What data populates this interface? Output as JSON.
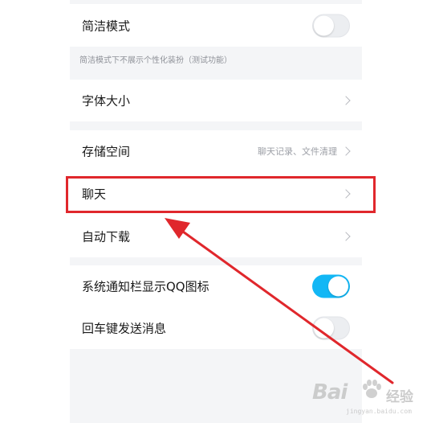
{
  "settings": {
    "simple_mode": {
      "label": "简洁模式",
      "enabled": false,
      "hint": "简洁模式下不展示个性化装扮（测试功能）"
    },
    "font_size": {
      "label": "字体大小"
    },
    "storage": {
      "label": "存储空间",
      "value": "聊天记录、文件清理"
    },
    "chat": {
      "label": "聊天"
    },
    "auto_download": {
      "label": "自动下载"
    },
    "notification_qq_icon": {
      "label": "系统通知栏显示QQ图标",
      "enabled": true
    },
    "enter_to_send": {
      "label": "回车键发送消息",
      "enabled": false
    }
  },
  "colors": {
    "toggle_on": "#12b7f5",
    "annotation": "#e0272c",
    "panel_bg": "#f4f5f7"
  },
  "icons": {
    "chevron": "chevron-right-icon",
    "watermark": "baidu-paw-icon"
  },
  "watermark": {
    "brand": "Bai",
    "brand_suffix": "经验",
    "url": "jingyan.baidu.com"
  }
}
